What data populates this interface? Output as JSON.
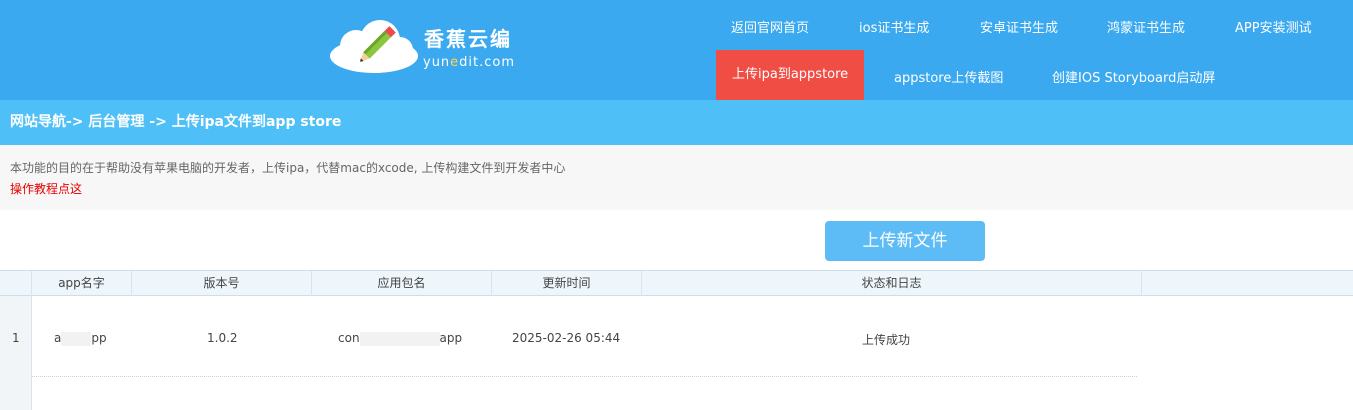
{
  "brand": {
    "name": "香蕉云编",
    "domain_pre": "yun",
    "domain_e": "e",
    "domain_post": "dit.com"
  },
  "nav": {
    "home": "返回官网首页",
    "ios_cert": "ios证书生成",
    "android_cert": "安卓证书生成",
    "harmony_cert": "鸿蒙证书生成",
    "app_install": "APP安装测试",
    "upload_ipa": "上传ipa到appstore",
    "screenshot": "appstore上传截图",
    "storyboard": "创建IOS Storyboard启动屏"
  },
  "breadcrumb": "网站导航-> 后台管理 -> 上传ipa文件到app store",
  "notice": {
    "text": "本功能的目的在于帮助没有苹果电脑的开发者，上传ipa，代替mac的xcode, 上传构建文件到开发者中心",
    "tutorial": "操作教程点这"
  },
  "upload_button": "上传新文件",
  "table": {
    "headers": [
      "app名字",
      "版本号",
      "应用包名",
      "更新时间",
      "状态和日志"
    ],
    "rows": [
      {
        "num": "1",
        "name_start": "a",
        "name_end": "pp",
        "version": "1.0.2",
        "pkg_start": "con",
        "pkg_end": "app",
        "time": "2025-02-26 05:44",
        "status": "上传成功"
      }
    ]
  },
  "colors": {
    "header": "#3aa9f0",
    "breadcrumb": "#4fc0f7",
    "active_nav": "#f04d44",
    "button": "#5dbcf6",
    "tutorial_link": "#e60000"
  }
}
